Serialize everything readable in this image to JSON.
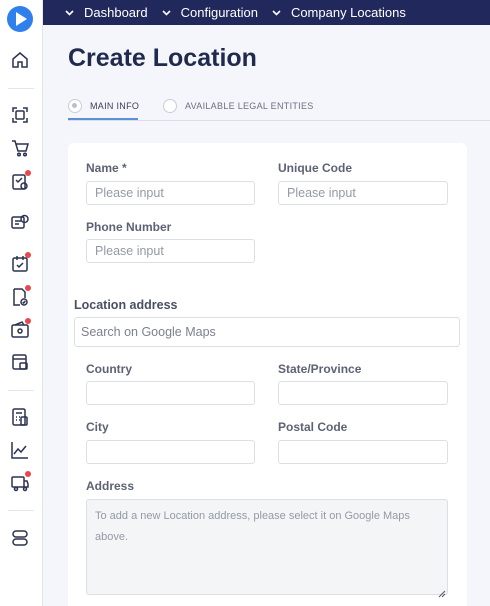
{
  "breadcrumbs": [
    "Dashboard",
    "Configuration",
    "Company Locations"
  ],
  "page": {
    "title": "Create Location"
  },
  "tabs": [
    {
      "label": "MAIN INFO",
      "active": true
    },
    {
      "label": "AVAILABLE LEGAL ENTITIES",
      "active": false
    }
  ],
  "form": {
    "name": {
      "label": "Name *",
      "placeholder": "Please input"
    },
    "unique_code": {
      "label": "Unique Code",
      "placeholder": "Please input"
    },
    "phone": {
      "label": "Phone Number",
      "placeholder": "Please input"
    },
    "location_address": {
      "label": "Location address",
      "placeholder": "Search on Google Maps"
    },
    "country": {
      "label": "Country"
    },
    "state": {
      "label": "State/Province"
    },
    "city": {
      "label": "City"
    },
    "postal": {
      "label": "Postal Code"
    },
    "address": {
      "label": "Address",
      "placeholder": "To add a new Location address, please select it on Google Maps above."
    }
  },
  "sidebar": {
    "icons": [
      "home-icon",
      "scan-icon",
      "cart-icon",
      "approval-icon",
      "finance-icon",
      "task-check-icon",
      "document-check-icon",
      "wallet-icon",
      "card-list-icon",
      "calculator-icon",
      "chart-icon",
      "delivery-icon",
      "settings-toggle-icon"
    ]
  },
  "colors": {
    "topbar": "#21295c",
    "title": "#1f2a4d",
    "accent": "#5b8fd6",
    "logo": "#2f80ed",
    "notification": "#e8474c"
  }
}
